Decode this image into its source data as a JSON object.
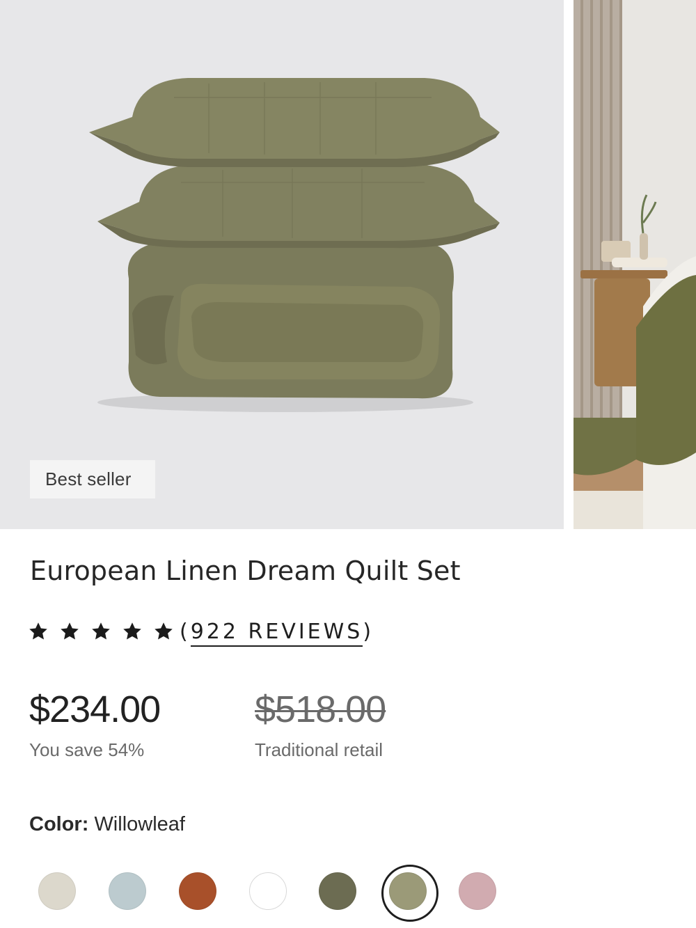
{
  "gallery": {
    "badge": "Best seller",
    "main_image_alt": "Folded quilt with two shams",
    "next_image_alt": "Quilt on bed lifestyle"
  },
  "product": {
    "title": "European Linen Dream Quilt Set",
    "rating_stars": 5,
    "reviews_open": "(",
    "reviews_text": "922 REVIEWS",
    "reviews_close": ")",
    "price": "$234.00",
    "savings": "You save 54%",
    "compare_price": "$518.00",
    "compare_label": "Traditional retail"
  },
  "color": {
    "label": "Color:",
    "selected_name": "Willowleaf",
    "swatches": [
      {
        "name": "Bone",
        "hex": "#dcd8cc"
      },
      {
        "name": "Mist",
        "hex": "#bccbcf"
      },
      {
        "name": "Terracotta",
        "hex": "#a8502a"
      },
      {
        "name": "White",
        "hex": "#ffffff"
      },
      {
        "name": "Olive",
        "hex": "#6c6c52"
      },
      {
        "name": "Willowleaf",
        "hex": "#9b9a78"
      },
      {
        "name": "Blush",
        "hex": "#d1abb0"
      }
    ]
  },
  "colors": {
    "star": "#1b1b1b",
    "text": "#2a2a2a",
    "muted": "#6a6a6a"
  }
}
